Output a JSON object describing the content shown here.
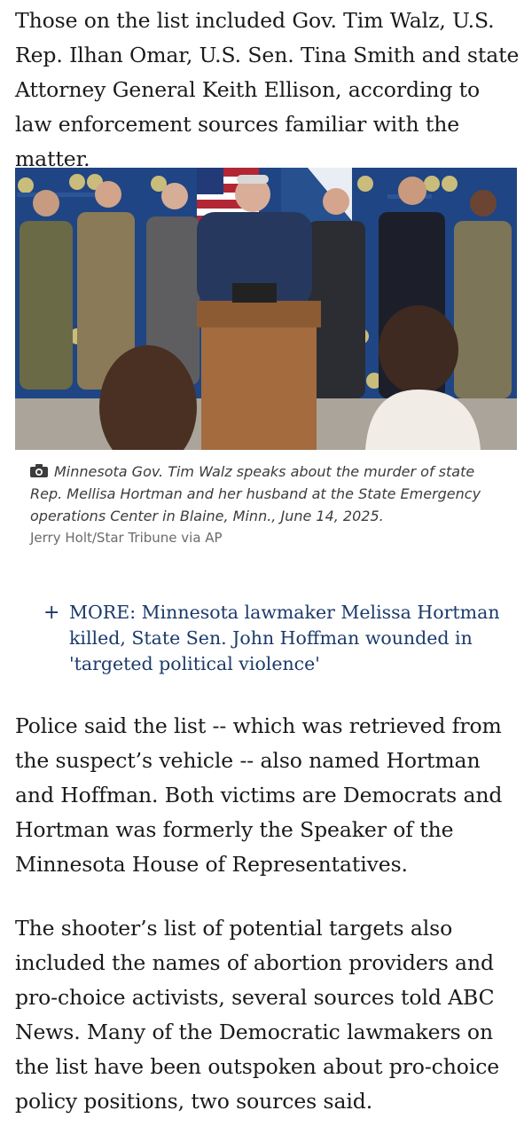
{
  "article": {
    "paragraph_1": "Those on the list included Gov. Tim Walz, U.S. Rep. Ilhan Omar, U.S. Sen. Tina Smith and state Attorney General Keith Ellison, according to law enforcement sources familiar with the matter.",
    "paragraph_2": "Police said the list -- which was retrieved from the suspect’s vehicle -- also named Hortman and Hoffman. Both victims are Democrats and Hortman was formerly the Speaker of the Minnesota House of Representatives.",
    "paragraph_3": "The shooter’s list of potential targets also included the names of abortion providers and pro-choice activists, several sources told ABC News. Many of the Democratic lawmakers on the list have been outspoken about pro-choice policy positions, two sources said."
  },
  "photo": {
    "icon": "camera-icon",
    "caption": "Minnesota Gov. Tim Walz speaks about the murder of state Rep. Mellisa Hortman and her husband at the State Emergency operations Center in Blaine, Minn., June 14, 2025.",
    "credit": "Jerry Holt/Star Tribune via AP"
  },
  "related": {
    "icon": "plus-icon",
    "link_text": "MORE: Minnesota lawmaker Melissa Hortman killed, State Sen. John Hoffman wounded in 'targeted political violence'"
  },
  "colors": {
    "body_text": "#1a1a1a",
    "link": "#1b3a6b",
    "caption": "#3c3c3c",
    "credit": "#6b6b6b"
  }
}
